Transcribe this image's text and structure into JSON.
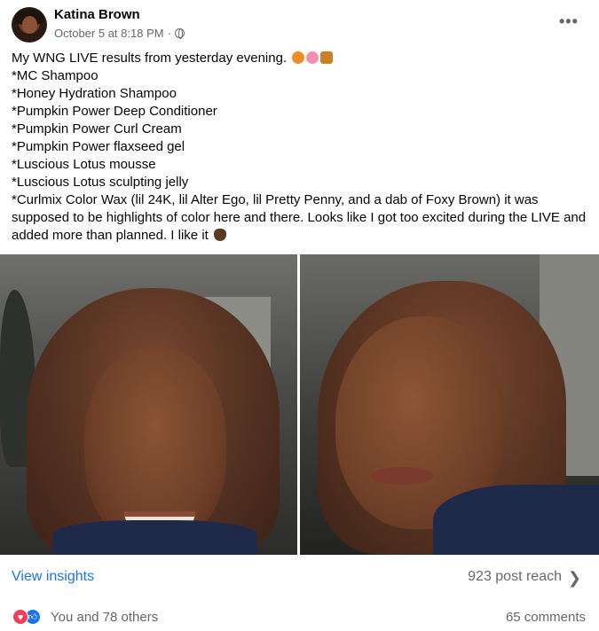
{
  "post": {
    "author": "Katina Brown",
    "timestamp": "October 5 at 8:18 PM",
    "separator": "·",
    "privacy_icon": "globe-icon",
    "more_icon": "more-options-icon",
    "lines": [
      "My WNG LIVE results from yesterday evening.",
      "*MC Shampoo",
      "*Honey Hydration Shampoo",
      "*Pumpkin Power Deep Conditioner",
      "*Pumpkin Power Curl Cream",
      "*Pumpkin Power flaxseed gel",
      "*Luscious Lotus mousse",
      "*Luscious Lotus sculpting jelly"
    ],
    "paragraph": "*Curlmix Color Wax (lil 24K, lil Alter Ego, lil Pretty Penny, and a dab of Foxy Brown) it was supposed to be highlights of color here and there. Looks like I got too excited during the LIVE and added more than planned. I like it",
    "emoji_first_line": [
      "jack-o-lantern-emoji",
      "lotus-emoji",
      "honey-pot-emoji"
    ],
    "emoji_end": "ok-hand-emoji"
  },
  "photos": [
    {
      "name": "selfie-smiling-front"
    },
    {
      "name": "selfie-side-glance"
    }
  ],
  "insights": {
    "link": "View insights",
    "reach": "923 post reach",
    "chevron_icon": "chevron-right-icon"
  },
  "reactions": {
    "icons": [
      "love-reaction-icon",
      "like-reaction-icon"
    ],
    "summary": "You and 78 others",
    "comments": "65 comments"
  },
  "colors": {
    "link": "#1b74e4",
    "secondary_text": "#65676b",
    "love": "#f33e58",
    "like": "#1b74e4"
  }
}
